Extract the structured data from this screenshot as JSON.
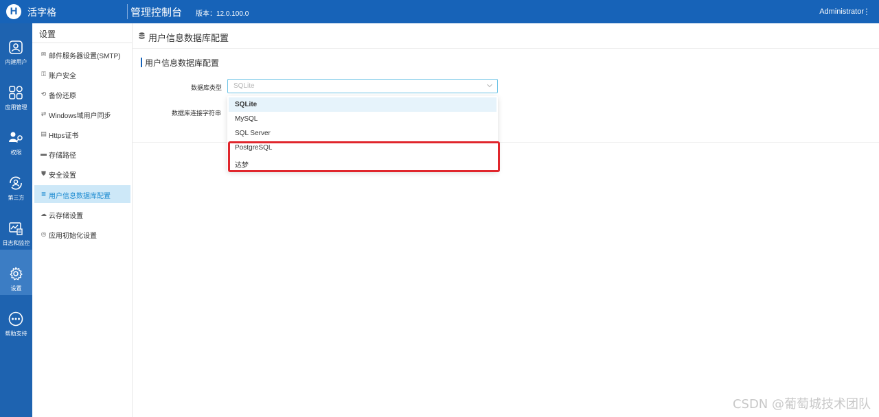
{
  "topbar": {
    "logo_letter": "H",
    "app_name": "活字格",
    "console_title": "管理控制台",
    "version": "版本：12.0.100.0",
    "user": "Administrator"
  },
  "leftnav": {
    "items": [
      {
        "label": "内建用户",
        "icon": "user-icon"
      },
      {
        "label": "应用管理",
        "icon": "apps-grid-icon"
      },
      {
        "label": "权限",
        "icon": "permission-key-icon"
      },
      {
        "label": "第三方",
        "icon": "third-party-icon"
      },
      {
        "label": "日志和监控",
        "icon": "log-monitor-icon"
      },
      {
        "label": "设置",
        "icon": "gear-icon",
        "active": true
      },
      {
        "label": "帮助支持",
        "icon": "more-dots-icon"
      }
    ]
  },
  "sidebar": {
    "title": "设置",
    "items": [
      {
        "label": "邮件服务器设置(SMTP)",
        "icon": "mail-icon"
      },
      {
        "label": "账户安全",
        "icon": "account-security-icon"
      },
      {
        "label": "备份还原",
        "icon": "backup-icon"
      },
      {
        "label": "Windows域用户同步",
        "icon": "windows-sync-icon"
      },
      {
        "label": "Https证书",
        "icon": "certificate-icon"
      },
      {
        "label": "存储路径",
        "icon": "folder-icon"
      },
      {
        "label": "安全设置",
        "icon": "shield-icon"
      },
      {
        "label": "用户信息数据库配置",
        "icon": "database-icon",
        "active": true
      },
      {
        "label": "云存储设置",
        "icon": "cloud-icon"
      },
      {
        "label": "应用初始化设置",
        "icon": "init-settings-icon"
      }
    ]
  },
  "main": {
    "header_title": "用户信息数据库配置",
    "section_title": "用户信息数据库配置",
    "form": {
      "db_type_label": "数据库类型",
      "db_type_value": "SQLite",
      "conn_string_label": "数据库连接字符串"
    },
    "dropdown": {
      "options": [
        "SQLite",
        "MySQL",
        "SQL Server",
        "PostgreSQL",
        "达梦"
      ],
      "selected": "SQLite"
    }
  },
  "watermark": "CSDN @葡萄城技术团队",
  "colors": {
    "topbar": "#1763b8",
    "leftnav": "#1e63b0",
    "active_sidebar_bg": "#cde8f8",
    "highlight_border": "#e0262c"
  }
}
